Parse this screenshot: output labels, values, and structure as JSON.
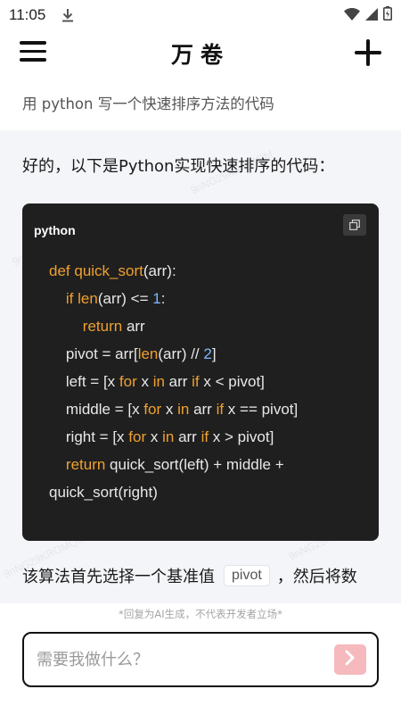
{
  "status_bar": {
    "time": "11:05"
  },
  "header": {
    "title": "万卷"
  },
  "conversation": {
    "user_query": "用 python 写一个快速排序方法的代码",
    "answer_intro": "好的，以下是Python实现快速排序的代码：",
    "code_block": {
      "language": "python",
      "lines": [
        [
          {
            "t": "def ",
            "c": "kw"
          },
          {
            "t": "quick_sort",
            "c": "fn"
          },
          {
            "t": "(arr):",
            "c": ""
          }
        ],
        [
          {
            "t": "    ",
            "c": ""
          },
          {
            "t": "if ",
            "c": "kw"
          },
          {
            "t": "len",
            "c": "fn"
          },
          {
            "t": "(arr) <= ",
            "c": ""
          },
          {
            "t": "1",
            "c": "num"
          },
          {
            "t": ":",
            "c": ""
          }
        ],
        [
          {
            "t": "        ",
            "c": ""
          },
          {
            "t": "return ",
            "c": "kw"
          },
          {
            "t": "arr",
            "c": ""
          }
        ],
        [
          {
            "t": "    pivot = arr[",
            "c": ""
          },
          {
            "t": "len",
            "c": "fn"
          },
          {
            "t": "(arr) // ",
            "c": ""
          },
          {
            "t": "2",
            "c": "num"
          },
          {
            "t": "]",
            "c": ""
          }
        ],
        [
          {
            "t": "    left = [x ",
            "c": ""
          },
          {
            "t": "for ",
            "c": "kw"
          },
          {
            "t": "x ",
            "c": ""
          },
          {
            "t": "in ",
            "c": "kw"
          },
          {
            "t": "arr ",
            "c": ""
          },
          {
            "t": "if ",
            "c": "kw"
          },
          {
            "t": "x < pivot]",
            "c": ""
          }
        ],
        [
          {
            "t": "    middle = [x ",
            "c": ""
          },
          {
            "t": "for ",
            "c": "kw"
          },
          {
            "t": "x ",
            "c": ""
          },
          {
            "t": "in ",
            "c": "kw"
          },
          {
            "t": "arr ",
            "c": ""
          },
          {
            "t": "if ",
            "c": "kw"
          },
          {
            "t": "x == pivot]",
            "c": ""
          }
        ],
        [
          {
            "t": "    right = [x ",
            "c": ""
          },
          {
            "t": "for ",
            "c": "kw"
          },
          {
            "t": "x ",
            "c": ""
          },
          {
            "t": "in ",
            "c": "kw"
          },
          {
            "t": "arr ",
            "c": ""
          },
          {
            "t": "if ",
            "c": "kw"
          },
          {
            "t": "x > pivot]",
            "c": ""
          }
        ],
        [
          {
            "t": "    ",
            "c": ""
          },
          {
            "t": "return ",
            "c": "kw"
          },
          {
            "t": "quick_sort(left) + middle +",
            "c": ""
          }
        ],
        [
          {
            "t": "quick_sort(right)",
            "c": ""
          }
        ]
      ]
    },
    "answer_tail_before": "该算法首先选择一个基准值",
    "answer_tail_code": "pivot",
    "answer_tail_after": "，然后将数"
  },
  "watermark_text": "9nNG29KROMQM",
  "footer": {
    "disclaimer": "*回复为AI生成，不代表开发者立场*",
    "input_placeholder": "需要我做什么？"
  },
  "colors": {
    "send_button": "#f6b9bd",
    "code_keyword": "#f0a030",
    "code_number": "#7fb7ff",
    "code_background": "#1f1f1f"
  },
  "icons": [
    "download-icon",
    "wifi-icon",
    "signal-icon",
    "battery-icon",
    "menu-icon",
    "plus-icon",
    "copy-icon",
    "chevron-right-icon"
  ]
}
